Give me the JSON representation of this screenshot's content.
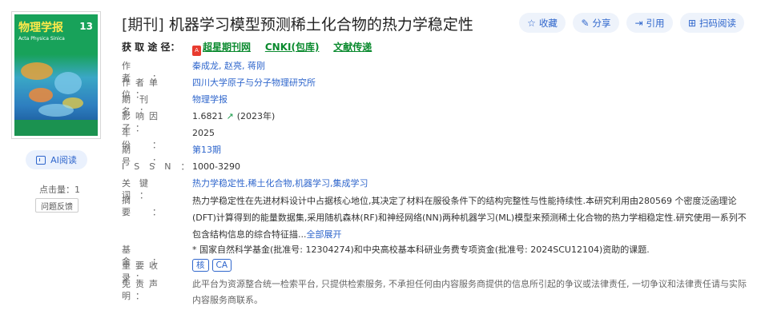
{
  "cover": {
    "journal_name": "物理学报",
    "issue_number": "13",
    "english_name": "Acta Physica Sinica"
  },
  "left": {
    "ai_label": "AI阅读",
    "clicks_label": "点击量：",
    "clicks_value": "1",
    "feedback_label": "问题反馈"
  },
  "header": {
    "type_tag": "[期刊]",
    "title": "机器学习模型预测稀土化合物的热力学稳定性",
    "actions": [
      {
        "icon": "☆",
        "label": "收藏"
      },
      {
        "icon": "✎",
        "label": "分享"
      },
      {
        "icon": "⇥",
        "label": "引用"
      },
      {
        "icon": "⊞",
        "label": "扫码阅读"
      }
    ]
  },
  "source": {
    "label": "获 取 途 径：",
    "links": [
      "超星期刊网",
      "CNKI(包库)",
      "文献传递"
    ]
  },
  "fields": {
    "author_label": "作者：",
    "authors": "秦成龙,  赵亮,  蒋刚",
    "unit_label": "作者单位：",
    "unit": "四川大学原子与分子物理研究所",
    "journal_label": "期刊名：",
    "journal": "物理学报",
    "impact_label": "影响因子：",
    "impact_value": "1.6821",
    "impact_year": "(2023年)",
    "year_label": "年份：",
    "year": "2025",
    "issue_label": "期号：",
    "issue": "第13期",
    "issn_label": "ISSN：",
    "issn": "1000-3290",
    "keywords_label": "关键词：",
    "keywords": "热力学稳定性,稀土化合物,机器学习,集成学习",
    "abstract_label": "摘要：",
    "abstract": "热力学稳定性在先进材料设计中占据核心地位,其决定了材料在服役条件下的结构完整性与性能持续性.本研究利用由280569 个密度泛函理论(DFT)计算得到的能量数据集,采用随机森林(RF)和神经网络(NN)两种机器学习(ML)模型来预测稀土化合物的热力学相稳定性.研究使用一系列不包含结构信息的综合特征描...",
    "expand_label": "全部展开",
    "fund_label": "基金：",
    "fund": "* 国家自然科学基金(批准号: 12304274)和中央高校基本科研业务费专项资金(批准号: 2024SCU12104)资助的课题.",
    "index_label": "重要收录：",
    "index_badges": [
      "核",
      "CA"
    ],
    "disclaimer_label": "免责声明：",
    "disclaimer": "此平台为资源整合统一检索平台, 只提供检索服务, 不承担任何由内容服务商提供的信息所引起的争议或法律责任, 一切争议和法律责任请与实际内容服务商联系。"
  },
  "colors": {
    "link_blue": "#2f66cc",
    "source_green": "#0a8a2e",
    "cover_green": "#18a25a"
  }
}
